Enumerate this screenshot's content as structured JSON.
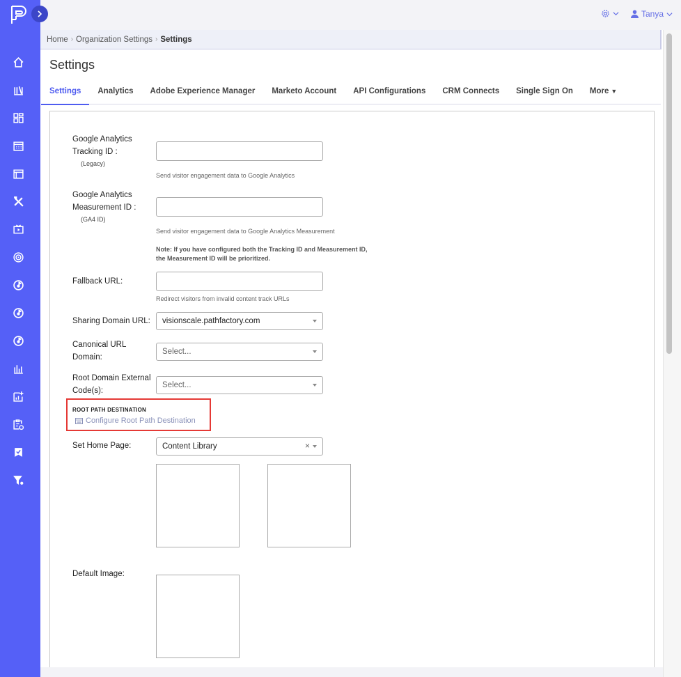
{
  "sidebar": {
    "icons": [
      "home-icon",
      "library-icon",
      "dashboard-icon",
      "calendar-icon",
      "window-icon",
      "tools-icon",
      "video-icon",
      "target-icon",
      "campaign-icon",
      "campaign-icon-2",
      "campaign-icon-3",
      "bar-chart-icon",
      "report-add-icon",
      "clipboard-icon",
      "bookmark-check-icon",
      "filter-icon"
    ],
    "color": "#5560f7"
  },
  "topbar": {
    "user_name": "Tanya"
  },
  "breadcrumb": {
    "home": "Home",
    "org_settings": "Organization Settings",
    "current": "Settings"
  },
  "page": {
    "title": "Settings"
  },
  "tabs": [
    {
      "label": "Settings"
    },
    {
      "label": "Analytics"
    },
    {
      "label": "Adobe Experience Manager"
    },
    {
      "label": "Marketo Account"
    },
    {
      "label": "API Configurations"
    },
    {
      "label": "CRM Connects"
    },
    {
      "label": "Single Sign On"
    },
    {
      "label": "More"
    }
  ],
  "form": {
    "ga_tracking": {
      "label_1": "Google Analytics",
      "label_2": "Tracking ID :",
      "sublabel": "(Legacy)",
      "value": "",
      "hint": "Send visitor engagement data to Google Analytics"
    },
    "ga_measurement": {
      "label_1": "Google Analytics",
      "label_2": "Measurement ID :",
      "sublabel": "(GA4 ID)",
      "value": "",
      "hint": "Send visitor engagement data to Google Analytics Measurement"
    },
    "note_1": "Note: If you have configured both the Tracking ID and Measurement ID,",
    "note_2": "the Measurement ID will be prioritized.",
    "fallback": {
      "label": "Fallback URL:",
      "value": "",
      "hint": "Redirect visitors from invalid content track URLs"
    },
    "sharing_domain": {
      "label": "Sharing Domain URL:",
      "value": "visionscale.pathfactory.com"
    },
    "canonical": {
      "label_1": "Canonical URL",
      "label_2": "Domain:",
      "placeholder": "Select..."
    },
    "root_domain": {
      "label_1": "Root Domain External",
      "label_2": "Code(s):",
      "placeholder": "Select..."
    },
    "root_path": {
      "title": "ROOT PATH DESTINATION",
      "link": "Configure Root Path Destination"
    },
    "home_page": {
      "label": "Set Home Page:",
      "value": "Content Library",
      "clear": "×"
    },
    "default_image": {
      "label": "Default Image:"
    }
  },
  "colors": {
    "accent": "#4f5cf0",
    "highlight": "#e53935"
  }
}
